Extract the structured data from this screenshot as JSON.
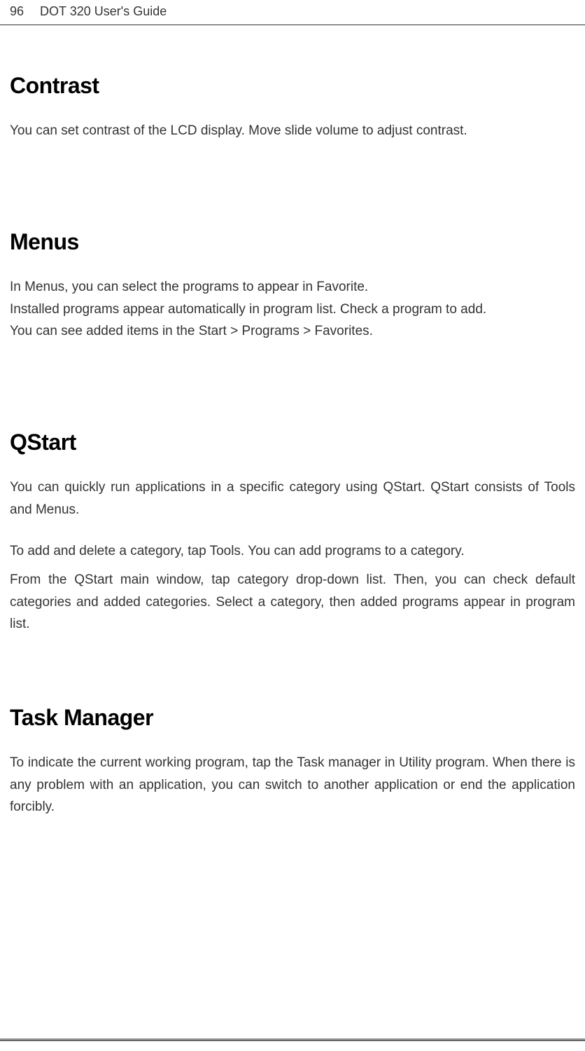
{
  "header": {
    "page_number": "96",
    "title": "DOT 320 User's Guide"
  },
  "sections": {
    "contrast": {
      "title": "Contrast",
      "body": "You can set contrast of the LCD display. Move slide volume to adjust contrast."
    },
    "menus": {
      "title": "Menus",
      "line1": "In Menus, you can select the programs to appear in Favorite.",
      "line2": "Installed programs appear automatically in program list. Check a program to add.",
      "line3": "You can see added items in the Start > Programs > Favorites."
    },
    "qstart": {
      "title": "QStart",
      "para1": "You can quickly run applications in a specific category using QStart. QStart consists of Tools and Menus.",
      "para2": "To add and delete a category, tap Tools. You can add programs to a category.",
      "para3": "From the QStart main window, tap category drop-down list. Then, you can check default categories and added categories. Select a category, then added programs appear in program list."
    },
    "taskmanager": {
      "title": "Task Manager",
      "body": "To indicate the current working program, tap the Task manager in Utility program. When there is any problem with an application, you can switch to another application or end the application forcibly."
    }
  }
}
